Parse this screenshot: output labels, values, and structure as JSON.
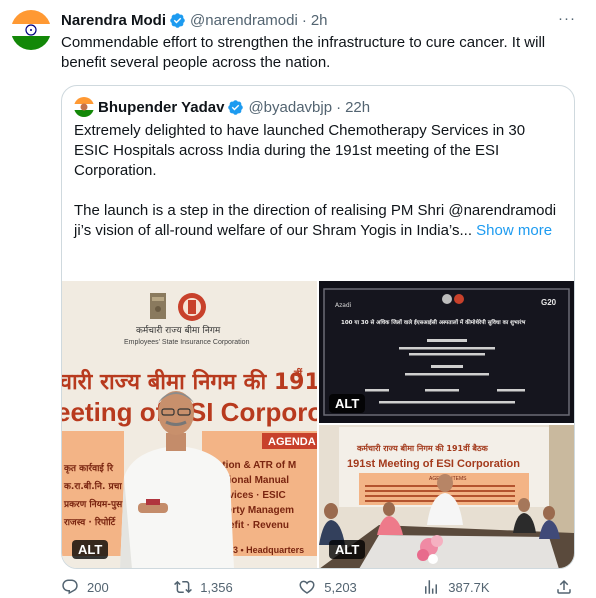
{
  "tweet": {
    "author_name": "Narendra Modi",
    "author_handle": "@narendramodi",
    "separator": "·",
    "time": "2h",
    "more_label": "···",
    "text": "Commendable effort to strengthen the infrastructure to cure cancer. It will benefit several people across the nation."
  },
  "quoted_tweet": {
    "author_name": "Bhupender Yadav",
    "author_handle": "@byadavbjp",
    "separator": "·",
    "time": "22h",
    "paragraph_1": "Extremely delighted to have launched Chemotherapy Services in 30 ESIC Hospitals across India during the 191st meeting of the ESI Corporation.",
    "paragraph_2": "The launch is a step in the direction of realising PM Shri @narendramodi ji’s vision of all-round welfare of our Shram Yogis in India’s...",
    "show_more": "Show more",
    "media": {
      "alt_label": "ALT",
      "image_1": {
        "org_hindi": "कर्मचारी राज्य बीमा निगम",
        "org_english": "Employees' State Insurance Corporation",
        "banner_hindi": "चारी राज्य बीमा निगम की 191",
        "banner_hindi_superscript": "वीं",
        "banner_english": "eeting of ESI Corporo",
        "agenda_label": "AGENDA",
        "agenda_items": [
          "rmation & ATR of M",
          "perational Manual",
          "y Services · ESIC",
          "Property Managem",
          "· Benefit · Revenu"
        ],
        "left_items": [
          "कृत कार्रवाई रि",
          "क.रा.बी.नि. प्रचा",
          "प्रकरण नियम-पुस",
          "राजस्व · रिपोर्टि"
        ],
        "footer_text": "23 • Headquarters"
      },
      "image_2": {
        "title_hindi": "100 या 30 से अधिक जिलों वाले ईएसआईसी अस्पतालों में कीमोथेरेपी सुविधा का शुभारंभ",
        "logo_right": "G20"
      },
      "image_3": {
        "banner_hindi": "कर्मचारी राज्य बीमा निगम की 191वीं बैठक",
        "banner_english": "191st Meeting of ESI Corporation",
        "agenda_label": "AGENDA ITEMS"
      }
    }
  },
  "stats": {
    "replies": "200",
    "reposts": "1,356",
    "likes": "5,203",
    "views": "387.7K"
  },
  "colors": {
    "verified": "#1d9bf0",
    "secondary_text": "#536471",
    "link": "#1d9bf0",
    "border": "#cfd9de"
  }
}
